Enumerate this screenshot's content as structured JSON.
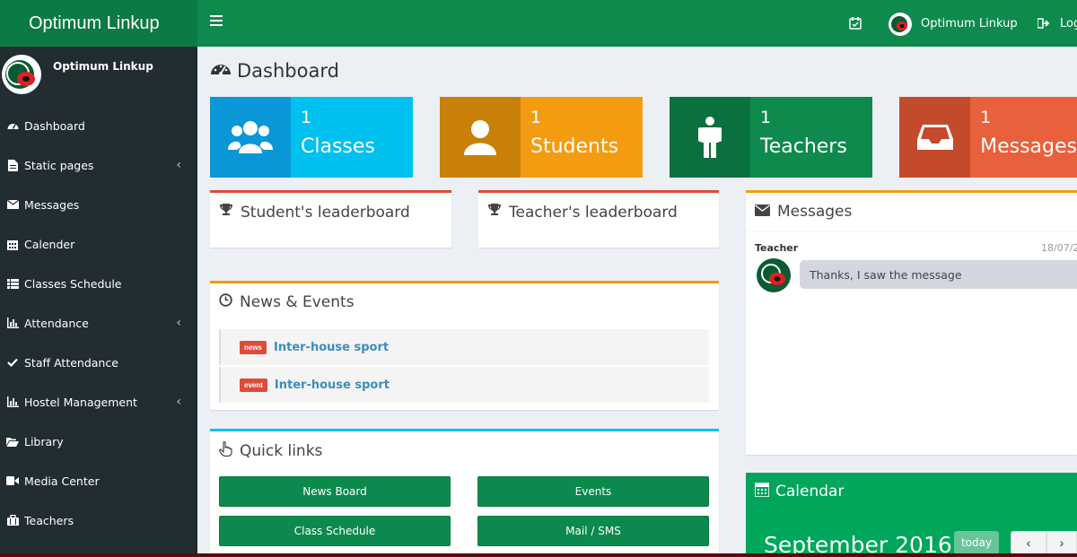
{
  "app": {
    "logo_text": "Optimum Linkup"
  },
  "navbar": {
    "user_name": "Optimum Linkup",
    "logout_label": "Log"
  },
  "sidebar": {
    "user_name": "Optimum Linkup",
    "items": [
      {
        "label": "Dashboard",
        "icon": "dashboard-icon"
      },
      {
        "label": "Static pages",
        "icon": "file-icon"
      },
      {
        "label": "Messages",
        "icon": "envelope-icon"
      },
      {
        "label": "Calender",
        "icon": "calendar-icon"
      },
      {
        "label": "Classes Schedule",
        "icon": "list-icon"
      },
      {
        "label": "Attendance",
        "icon": "bar-chart-icon"
      },
      {
        "label": "Staff Attendance",
        "icon": "check-icon"
      },
      {
        "label": "Hostel Management",
        "icon": "bar-chart-icon"
      },
      {
        "label": "Library",
        "icon": "folder-open-icon"
      },
      {
        "label": "Media Center",
        "icon": "video-camera-icon"
      },
      {
        "label": "Teachers",
        "icon": "briefcase-icon"
      }
    ]
  },
  "page": {
    "title": "Dashboard"
  },
  "stats": [
    {
      "value": "1",
      "label": "Classes",
      "icon": "users-icon",
      "color": "#00c0ef",
      "icon_bg": "#0a97d8"
    },
    {
      "value": "1",
      "label": "Students",
      "icon": "user-icon",
      "color": "#f39c12",
      "icon_bg": "#c98009"
    },
    {
      "value": "1",
      "label": "Teachers",
      "icon": "male-icon",
      "color": "#0e8a4d",
      "icon_bg": "#0a703e"
    },
    {
      "value": "1",
      "label": "Messages",
      "icon": "inbox-icon",
      "color": "#e8603c",
      "icon_bg": "#c44a2c"
    }
  ],
  "student_leaderboard": {
    "title": "Student's leaderboard"
  },
  "teacher_leaderboard": {
    "title": "Teacher's leaderboard"
  },
  "news": {
    "title": "News & Events",
    "items": [
      {
        "badge": "news",
        "text": "Inter-house sport"
      },
      {
        "badge": "event",
        "text": "Inter-house sport"
      }
    ]
  },
  "quick_links": {
    "title": "Quick links",
    "buttons": [
      "News Board",
      "Events",
      "Class Schedule",
      "Mail / SMS"
    ]
  },
  "messages": {
    "title": "Messages",
    "sender": "Teacher",
    "date": "18/07/2",
    "text": "Thanks, I saw the message"
  },
  "calendar": {
    "title": "Calendar",
    "month": "September 2016",
    "today_label": "today",
    "prev": "‹",
    "next": "›"
  }
}
